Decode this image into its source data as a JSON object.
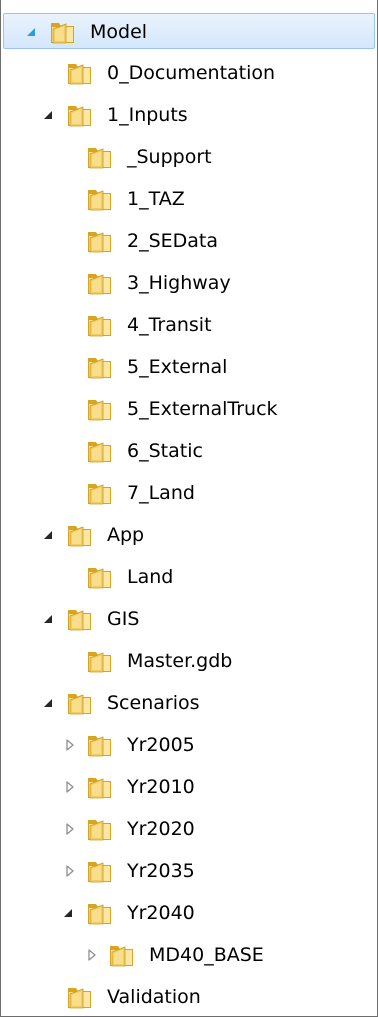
{
  "tree": {
    "nodes": [
      {
        "label": "Model",
        "expander": "expanded-hot",
        "selected": true
      },
      {
        "label": "0_Documentation",
        "expander": "none"
      },
      {
        "label": "1_Inputs",
        "expander": "expanded"
      },
      {
        "label": "_Support",
        "expander": "none"
      },
      {
        "label": "1_TAZ",
        "expander": "none"
      },
      {
        "label": "2_SEData",
        "expander": "none"
      },
      {
        "label": "3_Highway",
        "expander": "none"
      },
      {
        "label": "4_Transit",
        "expander": "none"
      },
      {
        "label": "5_External",
        "expander": "none"
      },
      {
        "label": "5_ExternalTruck",
        "expander": "none"
      },
      {
        "label": "6_Static",
        "expander": "none"
      },
      {
        "label": "7_Land",
        "expander": "none"
      },
      {
        "label": "App",
        "expander": "expanded"
      },
      {
        "label": "Land",
        "expander": "none"
      },
      {
        "label": "GIS",
        "expander": "expanded"
      },
      {
        "label": "Master.gdb",
        "expander": "none"
      },
      {
        "label": "Scenarios",
        "expander": "expanded"
      },
      {
        "label": "Yr2005",
        "expander": "collapsed"
      },
      {
        "label": "Yr2010",
        "expander": "collapsed"
      },
      {
        "label": "Yr2020",
        "expander": "collapsed"
      },
      {
        "label": "Yr2035",
        "expander": "collapsed"
      },
      {
        "label": "Yr2040",
        "expander": "expanded"
      },
      {
        "label": "MD40_BASE",
        "expander": "collapsed"
      },
      {
        "label": "Validation",
        "expander": "none"
      }
    ]
  },
  "icons": {
    "folder": "folder-icon",
    "expanded": "expanded-arrow-icon",
    "collapsed": "collapsed-arrow-icon"
  },
  "colors": {
    "selection_border": "#98c5f2",
    "selection_fill": "#d4e7fb",
    "folder_yellow": "#f2cd62",
    "hot_arrow": "#26a0da"
  }
}
